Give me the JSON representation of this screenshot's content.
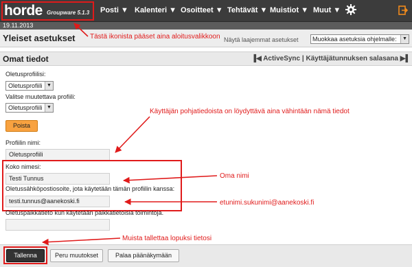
{
  "header": {
    "logo": "horde",
    "version": "Groupware 5.1.3",
    "menu": [
      {
        "label": "Posti ▼"
      },
      {
        "label": "Kalenteri ▼"
      },
      {
        "label": "Osoitteet ▼"
      },
      {
        "label": "Tehtävät ▼"
      },
      {
        "label": "Muistiot ▼"
      },
      {
        "label": "Muut ▼"
      }
    ]
  },
  "date": "19.11.2013",
  "page": {
    "title": "Yleiset asetukset",
    "more_prefs": "Näytä laajemmat asetukset",
    "app_select": "Muokkaa asetuksia ohjelmalle:"
  },
  "section": {
    "title": "Omat tiedot",
    "activesync": "ActiveSync",
    "separator": "|",
    "password": "Käyttäjätunnuksen salasana"
  },
  "form": {
    "default_profile_label": "Oletusprofiilisi:",
    "default_profile_value": "Oletusprofiili",
    "choose_profile_label": "Valitse muutettava profiili:",
    "choose_profile_value": "Oletusprofiili",
    "delete_button": "Poista",
    "profile_name_label": "Profiilin nimi:",
    "profile_name_value": "Oletusprofiili",
    "full_name_label": "Koko nimesi:",
    "full_name_value": "Testi Tunnus",
    "email_label": "Oletussähköpostiosoite, jota käytetään tämän profiilin kanssa:",
    "email_value": "testi.tunnus@aanekoski.fi",
    "location_label": "Oletuspaikkatieto kun käytetään paikkatietoisia toimintoja.",
    "location_value": ""
  },
  "buttons": {
    "save": "Tallenna",
    "undo": "Peru muutokset",
    "back": "Palaa päänäkymään"
  },
  "annotations": {
    "home_icon": "Tästä ikonista pääset aina aloitusvalikkoon",
    "basic_info": "Käyttäjän pohjatiedoista on löydyttävä aina vähintään nämä tiedot",
    "own_name": "Oma nimi",
    "email": "etunimi.sukunimi@aanekoski.fi",
    "remember_save": "Muista tallettaa lopuksi tietosi"
  },
  "colors": {
    "annotation": "#e01a1a",
    "topbar": "#3c3c3c",
    "delete_button": "#f8a240"
  }
}
